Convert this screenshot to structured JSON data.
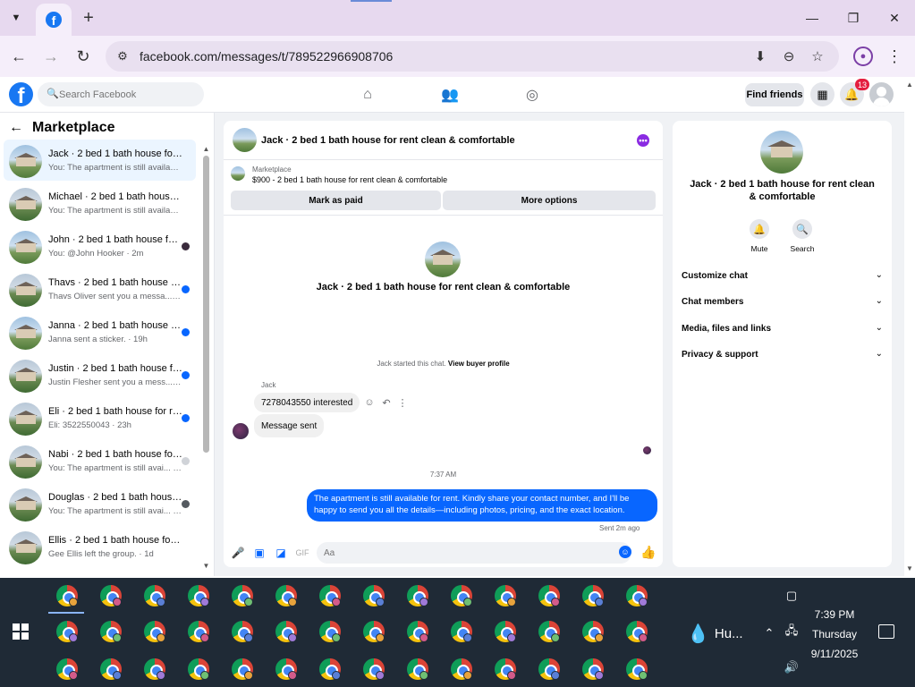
{
  "browser": {
    "url": "facebook.com/messages/t/789522966908706"
  },
  "facebook": {
    "search_placeholder": "Search Facebook",
    "find_friends": "Find friends",
    "notification_count": "13"
  },
  "sidebar": {
    "title": "Marketplace",
    "threads": [
      {
        "name": "Jack · 2 bed 1 bath house for re...",
        "preview": "You: The apartment is still availabl... · 2m",
        "active": true
      },
      {
        "name": "Michael · 2 bed 1 bath house fo...",
        "preview": "You: The apartment is still availabl... · 2m"
      },
      {
        "name": "John · 2 bed 1 bath house for...",
        "preview": "You: @John Hooker · 2m"
      },
      {
        "name": "Thavs · 2 bed 1 bath house fo...",
        "preview": "Thavs Oliver sent you a messa... · 17h"
      },
      {
        "name": "Janna · 2 bed 1 bath house fo...",
        "preview": "Janna sent a sticker. · 19h"
      },
      {
        "name": "Justin · 2 bed 1 bath house fo...",
        "preview": "Justin Flesher sent you a mess... · 22h"
      },
      {
        "name": "Eli · 2 bed 1 bath house for re...",
        "preview": "Eli: 3522550043 · 23h"
      },
      {
        "name": "Nabi · 2 bed 1 bath house for...",
        "preview": "You: The apartment is still avai... · 23h"
      },
      {
        "name": "Douglas · 2 bed 1 bath house...",
        "preview": "You: The apartment is still avai... · 23h"
      },
      {
        "name": "Ellis · 2 bed 1 bath house for re...",
        "preview": "Gee Ellis left the group. · 1d"
      }
    ]
  },
  "chat": {
    "title": "Jack · 2 bed 1 bath house for rent clean & comfortable",
    "marketplace_label": "Marketplace",
    "listing": "$900 - 2 bed 1 bath house for rent clean & comfortable",
    "mark_paid": "Mark as paid",
    "more_options": "More options",
    "conversation_title": "Jack · 2 bed 1 bath house for rent clean & comfortable",
    "started_text": "Jack started this chat.",
    "view_profile": "View buyer profile",
    "sender": "Jack",
    "msg1": "7278043550 interested",
    "msg2": "Message sent",
    "timestamp": "7:37 AM",
    "msg_out": "The apartment is still available for rent. Kindly share your contact number, and I'll be happy to send you all the details—including photos, pricing, and the exact location.",
    "sent_label": "Sent 2m ago",
    "composer_placeholder": "Aa"
  },
  "right_panel": {
    "title": "Jack · 2 bed 1 bath house for rent clean & comfortable",
    "mute": "Mute",
    "search": "Search",
    "rows": [
      "Customize chat",
      "Chat members",
      "Media, files and links",
      "Privacy & support"
    ]
  },
  "taskbar": {
    "weather": "Hu...",
    "time": "7:39 PM",
    "day": "Thursday",
    "date": "9/11/2025"
  },
  "colors": {
    "fb_blue": "#0866ff",
    "tab_strip": "#e7d9ef",
    "taskbar": "#1f2a36"
  }
}
